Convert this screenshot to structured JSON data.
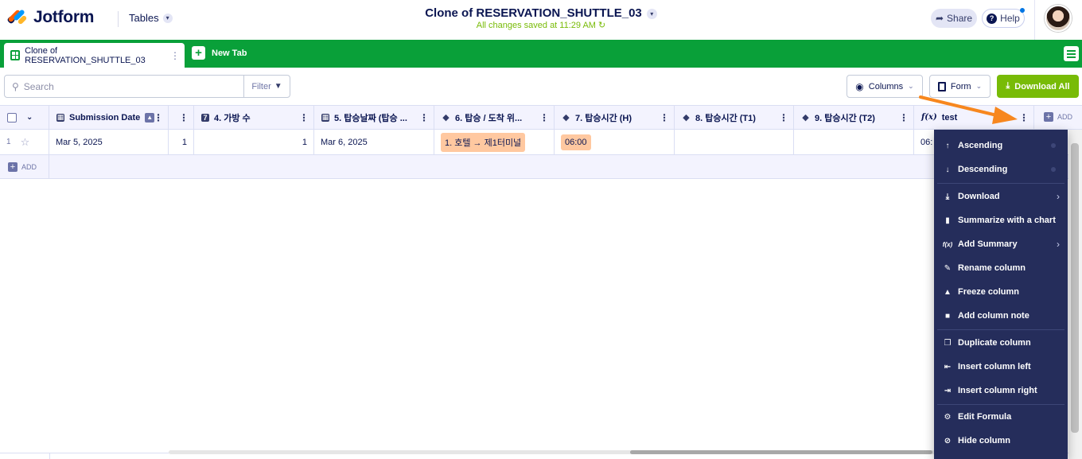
{
  "header": {
    "logo_text": "Jotform",
    "product_dropdown": "Tables",
    "doc_title": "Clone of RESERVATION_SHUTTLE_03",
    "save_status": "All changes saved at 11:29 AM",
    "share_label": "Share",
    "help_label": "Help"
  },
  "tabs": {
    "active_tab": "Clone of RESERVATION_SHUTTLE_03",
    "new_tab_label": "New Tab"
  },
  "toolbar": {
    "search_placeholder": "Search",
    "filter_label": "Filter",
    "columns_label": "Columns",
    "form_label": "Form",
    "download_all_label": "Download All"
  },
  "table": {
    "columns": [
      {
        "label": "Submission Date"
      },
      {
        "label": "4. 가방 수"
      },
      {
        "label": "5. 탑승날짜 (탑승 ..."
      },
      {
        "label": "6. 탑승 / 도착 위..."
      },
      {
        "label": "7. 탑승시간 (H)"
      },
      {
        "label": "8. 탑승시간 (T1)"
      },
      {
        "label": "9. 탑승시간 (T2)"
      },
      {
        "label": "test"
      }
    ],
    "add_column_label": "ADD",
    "add_row_label": "ADD",
    "rows": [
      {
        "row_number": "1",
        "submission_date": "Mar 5, 2025",
        "col_hidden": "1",
        "bags": "1",
        "boarding_date": "Mar 6, 2025",
        "location": "1. 호텔 → 제1터미널",
        "time_h": "06:00",
        "time_t1": "",
        "time_t2": "",
        "test": "06:"
      }
    ]
  },
  "column_menu": {
    "items": [
      {
        "label": "Ascending",
        "icon": "sort-asc-icon"
      },
      {
        "label": "Descending",
        "icon": "sort-desc-icon"
      },
      {
        "label": "Download",
        "icon": "download-icon"
      },
      {
        "label": "Summarize with a chart",
        "icon": "chart-icon"
      },
      {
        "label": "Add Summary",
        "icon": "formula-icon"
      },
      {
        "label": "Rename column",
        "icon": "pencil-icon"
      },
      {
        "label": "Freeze column",
        "icon": "pin-icon"
      },
      {
        "label": "Add column note",
        "icon": "note-icon"
      },
      {
        "label": "Duplicate column",
        "icon": "duplicate-icon"
      },
      {
        "label": "Insert column left",
        "icon": "insert-left-icon"
      },
      {
        "label": "Insert column right",
        "icon": "insert-right-icon"
      },
      {
        "label": "Edit Formula",
        "icon": "gear-icon"
      },
      {
        "label": "Hide column",
        "icon": "hide-icon"
      }
    ]
  },
  "colors": {
    "brand_navy": "#0a1551",
    "tab_green": "#09a039",
    "download_green": "#78bb07",
    "menu_bg": "#252d5b",
    "chip_orange": "#ffc8a0",
    "arrow_orange": "#f7871e"
  }
}
